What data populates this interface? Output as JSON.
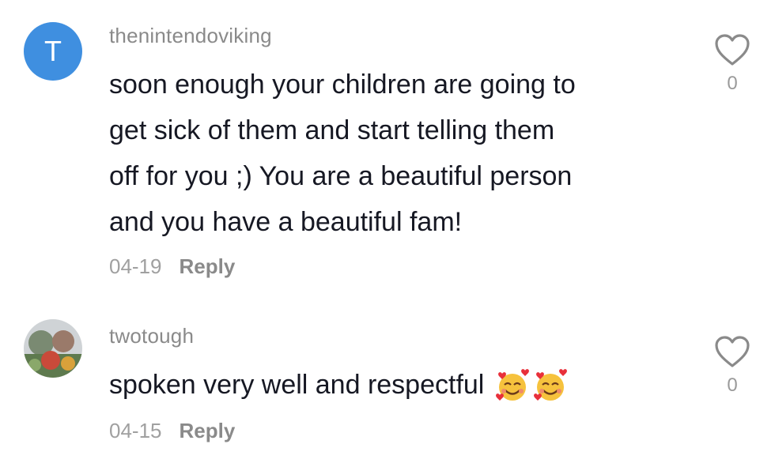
{
  "comments": [
    {
      "username": "thenintendoviking",
      "avatar_letter": "T",
      "text": "soon enough your children are going to get sick of them and start telling them off for you ;) You are a beautiful person and you have a beautiful fam!",
      "lines": [
        "soon enough your children are going to",
        "get sick of them and start telling them",
        "off for you ;) You are a beautiful person",
        "and you have a beautiful fam!"
      ],
      "date": "04-19",
      "reply_label": "Reply",
      "like_count": "0"
    },
    {
      "username": "twotough",
      "text": "spoken very well and respectful",
      "emojis": [
        "smiling-face-with-hearts",
        "smiling-face-with-hearts"
      ],
      "date": "04-15",
      "reply_label": "Reply",
      "like_count": "0"
    }
  ],
  "colors": {
    "avatar_bg": "#3f8fe0",
    "text": "#161823",
    "muted": "#8a8a8a"
  }
}
